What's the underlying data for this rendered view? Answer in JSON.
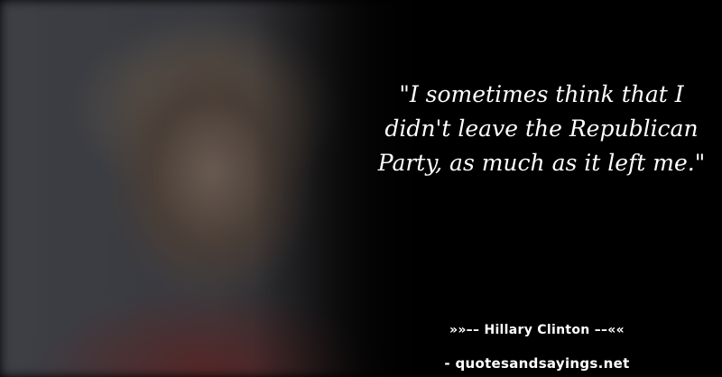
{
  "quote": {
    "text": "\"I sometimes think that I didn't leave the Republican Party, as much as it left me.\""
  },
  "attribution": {
    "author_line": "»»–– Hillary Clinton ––««",
    "source_line": "- quotesandsayings.net"
  },
  "colors": {
    "background": "#000000",
    "text": "#ffffff"
  }
}
